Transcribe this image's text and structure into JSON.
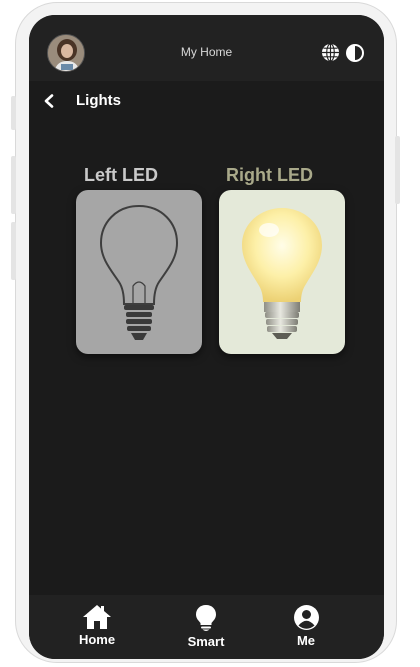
{
  "app": {
    "header_title": "My Home",
    "page_title": "Lights"
  },
  "lights": [
    {
      "label": "Left LED",
      "state": "off",
      "label_color": "#c9c9c9",
      "card_color": "#a6a6a6"
    },
    {
      "label": "Right LED",
      "state": "on",
      "label_color": "#a9a98a",
      "card_color": "#e4e9d9"
    }
  ],
  "nav": {
    "items": [
      {
        "label": "Home",
        "icon": "home-icon"
      },
      {
        "label": "Smart",
        "icon": "lightbulb-icon"
      },
      {
        "label": "Me",
        "icon": "user-icon"
      }
    ]
  },
  "icons": {
    "header_right": [
      "globe-icon",
      "contrast-icon"
    ],
    "back": "chevron-left-icon"
  },
  "colors": {
    "screen_bg": "#1b1b1b",
    "bar_bg": "#222222",
    "text": "#ffffff"
  }
}
